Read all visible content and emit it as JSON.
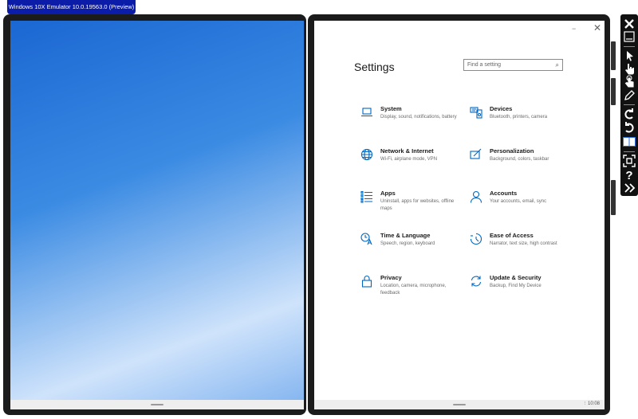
{
  "emulator": {
    "title": "Windows 10X Emulator 10.0.19563.0 (Preview)"
  },
  "settings": {
    "title": "Settings",
    "search_placeholder": "Find a setting",
    "window_minimize": "−",
    "window_close": "✕",
    "items": [
      {
        "name": "System",
        "desc": "Display, sound, notifications, battery",
        "icon": "laptop-icon"
      },
      {
        "name": "Devices",
        "desc": "Bluetooth, printers, camera",
        "icon": "devices-icon"
      },
      {
        "name": "Network & Internet",
        "desc": "Wi-Fi, airplane mode, VPN",
        "icon": "globe-icon"
      },
      {
        "name": "Personalization",
        "desc": "Background, colors, taskbar",
        "icon": "personalization-icon"
      },
      {
        "name": "Apps",
        "desc": "Uninstall, apps for websites, offline maps",
        "icon": "apps-list-icon"
      },
      {
        "name": "Accounts",
        "desc": "Your accounts, email, sync",
        "icon": "person-icon"
      },
      {
        "name": "Time & Language",
        "desc": "Speech, region, keyboard",
        "icon": "time-language-icon"
      },
      {
        "name": "Ease of Access",
        "desc": "Narrator, text size, high contrast",
        "icon": "ease-of-access-icon"
      },
      {
        "name": "Privacy",
        "desc": "Location, camera, microphone, feedback",
        "icon": "lock-icon"
      },
      {
        "name": "Update & Security",
        "desc": "Backup, Find My Device",
        "icon": "refresh-icon"
      }
    ]
  },
  "taskbar": {
    "time": "10:08"
  },
  "toolbar": {
    "buttons": [
      "close",
      "minimize",
      "select-pointer",
      "touch-pointer",
      "multi-touch",
      "pen",
      "rotate-left",
      "rotate-right",
      "dual-screen",
      "screenshot",
      "help",
      "expand-tools"
    ]
  },
  "colors": {
    "accent": "#0067c0",
    "emulator_tab": "#0b1ca8",
    "bezel": "#1b1b1b"
  }
}
